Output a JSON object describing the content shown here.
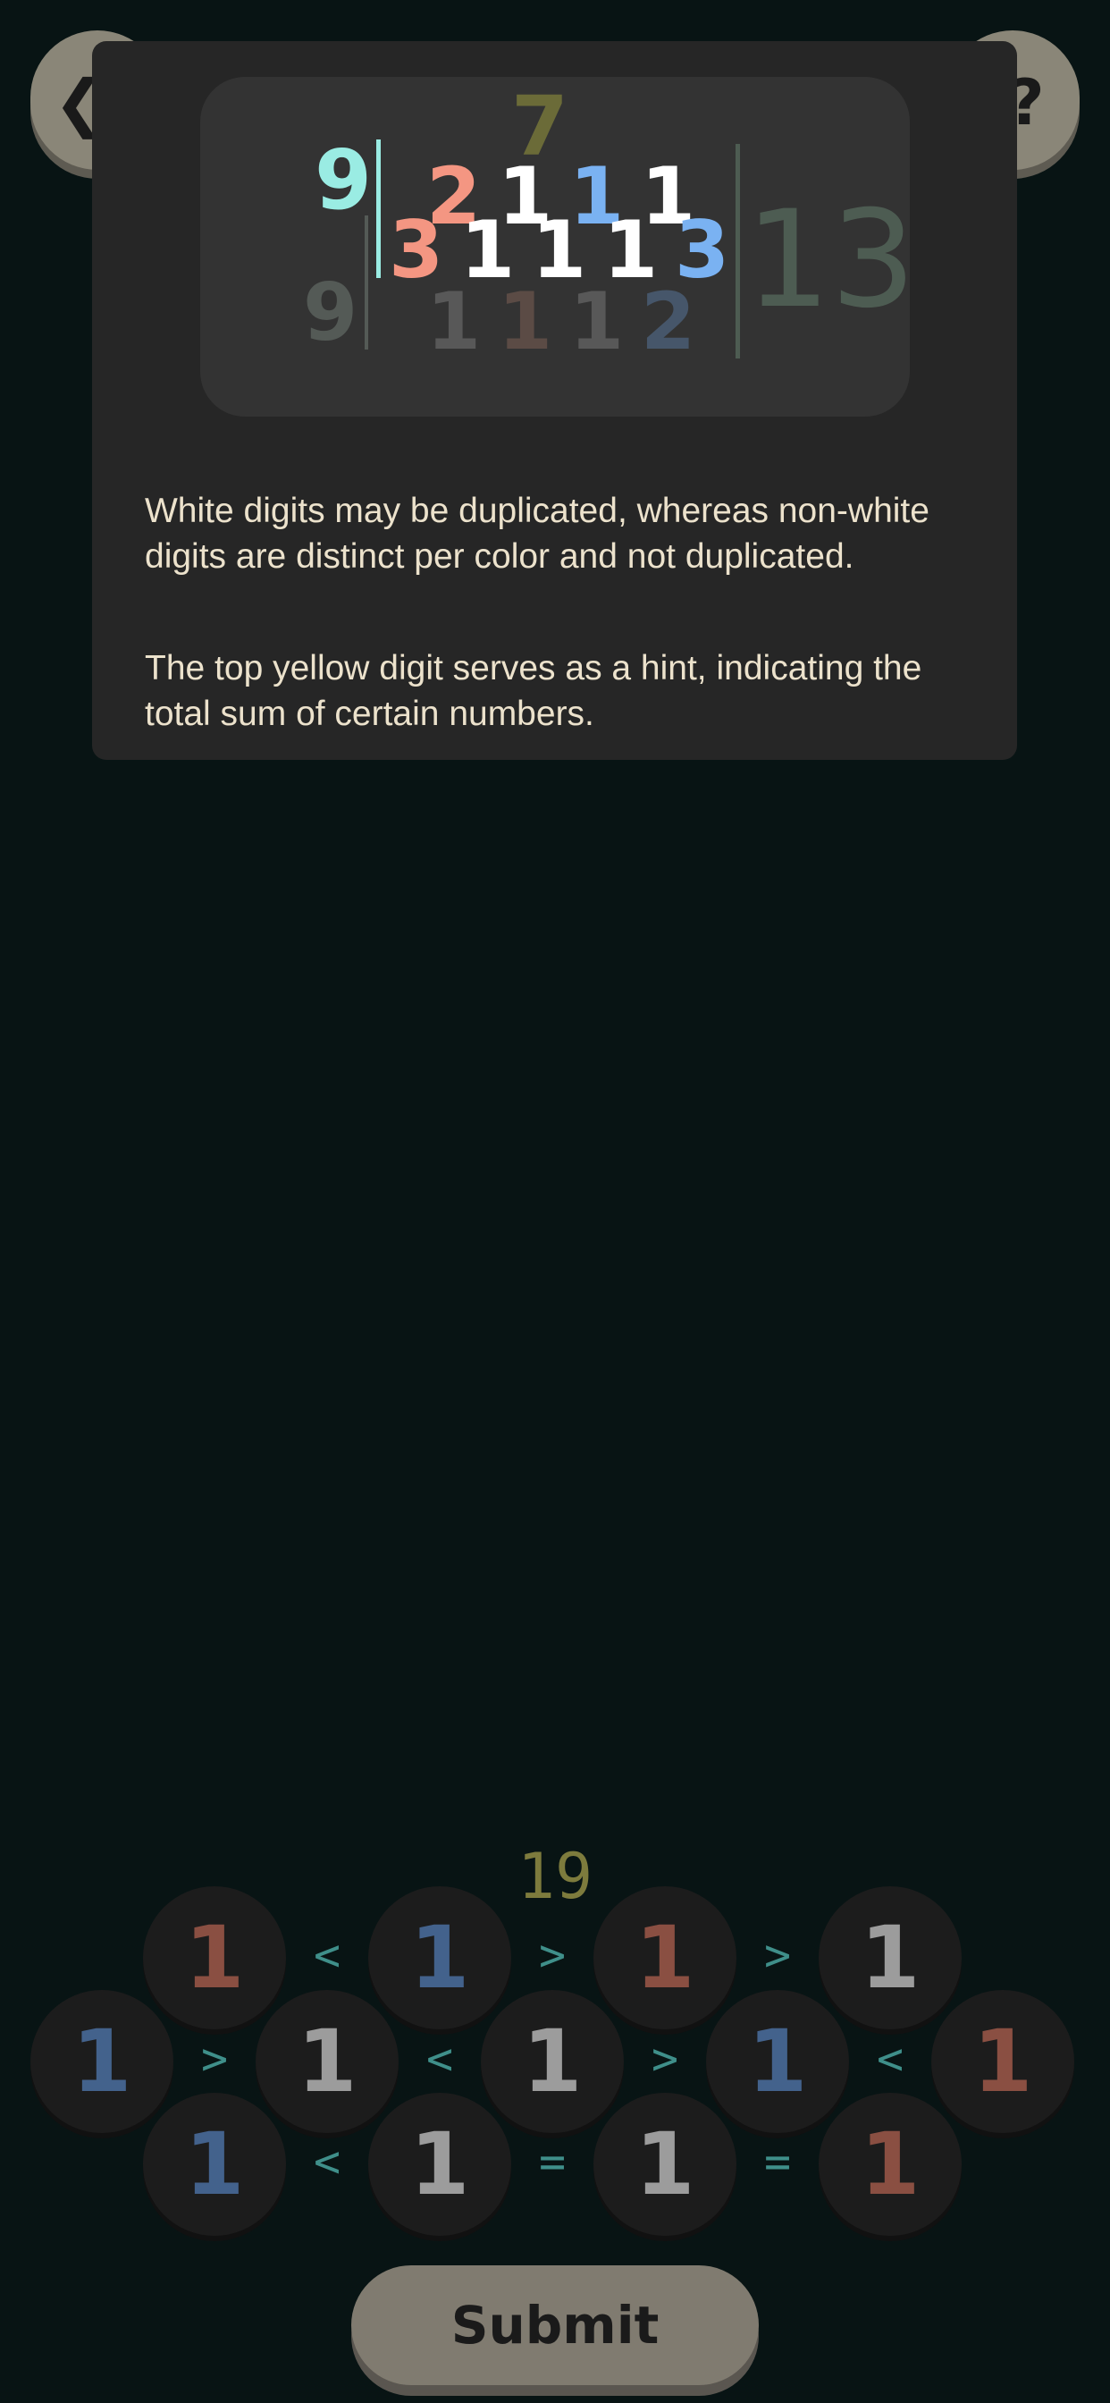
{
  "top_bar": {
    "back_icon": "chevron-left-icon",
    "help_icon": "question-icon"
  },
  "help": {
    "paragraphs": [
      "White digits may be duplicated, whereas non-white digits are distinct per color and not duplicated.",
      "The top yellow digit serves as a hint, indicating the total sum of certain numbers."
    ],
    "example": {
      "hint": "7",
      "left_top": "9",
      "left_bottom": "9",
      "row1": [
        {
          "d": "2",
          "c": "#f49682"
        },
        {
          "d": "1",
          "c": "#ffffff"
        },
        {
          "d": "1",
          "c": "#7ab2f2"
        },
        {
          "d": "1",
          "c": "#ffffff"
        }
      ],
      "row2": [
        {
          "d": "3",
          "c": "#f49682"
        },
        {
          "d": "1",
          "c": "#ffffff"
        },
        {
          "d": "1",
          "c": "#ffffff"
        },
        {
          "d": "1",
          "c": "#ffffff"
        },
        {
          "d": "3",
          "c": "#7ab2f2"
        }
      ],
      "row3": [
        {
          "d": "1",
          "c": "#585858"
        },
        {
          "d": "1",
          "c": "#5b4b45"
        },
        {
          "d": "1",
          "c": "#585858"
        },
        {
          "d": "2",
          "c": "#46566a"
        }
      ],
      "right_total": "13"
    }
  },
  "board": {
    "hint": "19",
    "rows": [
      {
        "cells": [
          {
            "d": "1",
            "c": "#8a4f42"
          },
          {
            "d": "1",
            "c": "#43628c"
          },
          {
            "d": "1",
            "c": "#8a4f42"
          },
          {
            "d": "1",
            "c": "#9c9c9c"
          }
        ],
        "ops": [
          "<",
          ">",
          ">"
        ]
      },
      {
        "cells": [
          {
            "d": "1",
            "c": "#43628c"
          },
          {
            "d": "1",
            "c": "#9c9c9c"
          },
          {
            "d": "1",
            "c": "#9c9c9c"
          },
          {
            "d": "1",
            "c": "#43628c"
          },
          {
            "d": "1",
            "c": "#8a4f42"
          }
        ],
        "ops": [
          ">",
          "<",
          ">",
          "<"
        ]
      },
      {
        "cells": [
          {
            "d": "1",
            "c": "#43628c"
          },
          {
            "d": "1",
            "c": "#9c9c9c"
          },
          {
            "d": "1",
            "c": "#9c9c9c"
          },
          {
            "d": "1",
            "c": "#8a4f42"
          }
        ],
        "ops": [
          "<",
          "=",
          "="
        ]
      }
    ]
  },
  "submit": {
    "label": "Submit"
  },
  "colors": {
    "background": "#081414",
    "panel": "#262626",
    "hint": "#7d7b3d",
    "operator": "#3f8f8a",
    "button": "#807b70"
  }
}
